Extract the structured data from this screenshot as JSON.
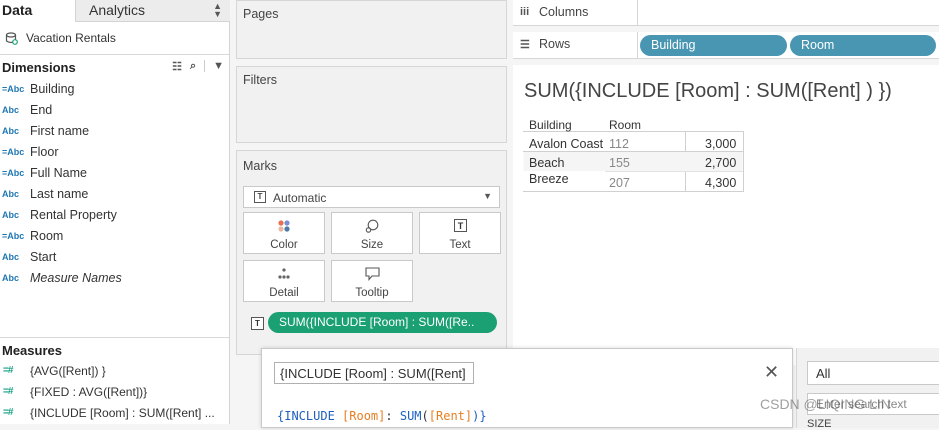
{
  "left_pane": {
    "tabs": {
      "data": "Data",
      "analytics": "Analytics"
    },
    "datasource": "Vacation Rentals",
    "dimensions_title": "Dimensions",
    "dimensions": [
      {
        "type": "=Abc",
        "label": "Building"
      },
      {
        "type": "Abc",
        "label": "End"
      },
      {
        "type": "Abc",
        "label": "First name"
      },
      {
        "type": "=Abc",
        "label": "Floor"
      },
      {
        "type": "=Abc",
        "label": "Full Name"
      },
      {
        "type": "Abc",
        "label": "Last name"
      },
      {
        "type": "Abc",
        "label": "Rental Property"
      },
      {
        "type": "=Abc",
        "label": "Room"
      },
      {
        "type": "Abc",
        "label": "Start"
      },
      {
        "type": "Abc",
        "label": "Measure Names"
      }
    ],
    "measures_title": "Measures",
    "measures": [
      {
        "type": "=#",
        "label": "{AVG([Rent]) }"
      },
      {
        "type": "=#",
        "label": "{FIXED : AVG([Rent])}"
      },
      {
        "type": "=#",
        "label": "{INCLUDE [Room] : SUM([Rent] ..."
      }
    ]
  },
  "cards": {
    "pages": "Pages",
    "filters": "Filters",
    "marks": "Marks",
    "marks_type": "Automatic",
    "mark_buttons": {
      "color": "Color",
      "size": "Size",
      "text": "Text",
      "detail": "Detail",
      "tooltip": "Tooltip"
    },
    "text_pill": "SUM({INCLUDE [Room] : SUM([Re.."
  },
  "shelves": {
    "columns": "Columns",
    "rows": "Rows",
    "row_pills": [
      "Building",
      "Room"
    ]
  },
  "view": {
    "title": "SUM({INCLUDE [Room] : SUM([Rent] ) })",
    "headers": {
      "building": "Building",
      "room": "Room"
    },
    "rows": [
      {
        "building": "Avalon Coast",
        "room": "112",
        "value": "3,000"
      },
      {
        "building": "Beach Breeze",
        "room": "155",
        "value": "2,700"
      },
      {
        "building": "",
        "room": "207",
        "value": "4,300"
      }
    ],
    "beach_line1": "Beach",
    "beach_line2": "Breeze"
  },
  "calc_editor": {
    "name": "{INCLUDE [Room] : SUM([Rent]",
    "formula_parts": [
      "{INCLUDE ",
      "[Room]",
      ": ",
      "SUM",
      "(",
      "[Rent]",
      ")}"
    ],
    "colors": {
      "keyword": "#1f5fbf",
      "field": "#e67e22",
      "plain": "#333333"
    }
  },
  "right_panel": {
    "filter_value": "All",
    "search_placeholder": "Enter search text",
    "size_label": "SIZE"
  },
  "watermark": "CSDN @LIQING LIN",
  "colors": {
    "row_pill": "#4996b2",
    "measure_pill": "#1aa073",
    "dimension_icon": "#1f77b4",
    "measure_icon": "#16a085"
  }
}
